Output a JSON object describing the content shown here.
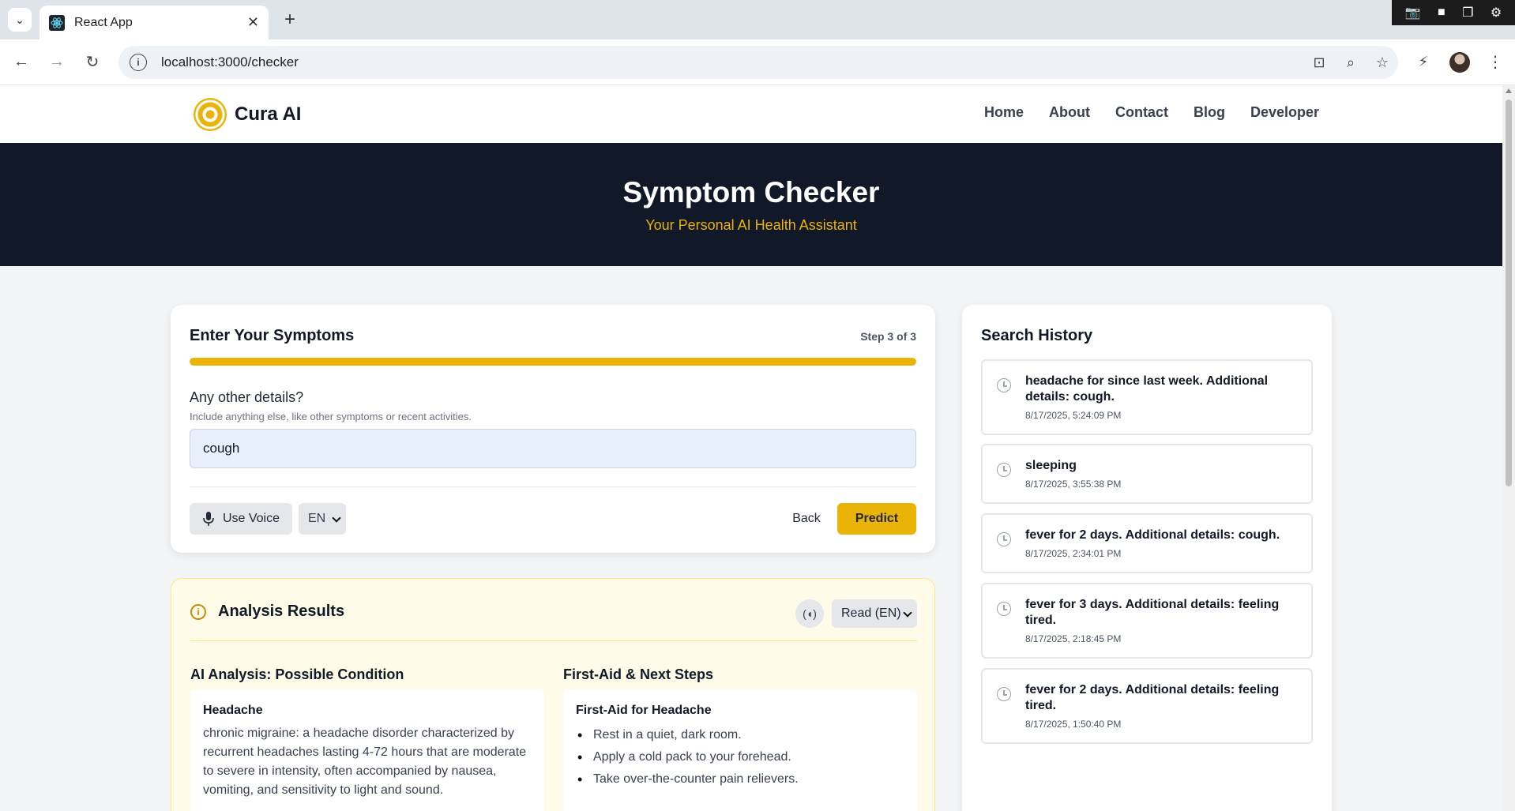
{
  "browser": {
    "tab_title": "React App",
    "url": "localhost:3000/checker"
  },
  "navbar": {
    "brand": "Cura AI",
    "links": [
      "Home",
      "About",
      "Contact",
      "Blog",
      "Developer"
    ]
  },
  "hero": {
    "title": "Symptom Checker",
    "subtitle": "Your Personal AI Health Assistant"
  },
  "symptom_form": {
    "title": "Enter Your Symptoms",
    "step_label": "Step 3 of 3",
    "progress": 1.0,
    "question": "Any other details?",
    "hint": "Include anything else, like other symptoms or recent activities.",
    "input_value": "cough",
    "voice_label": "Use Voice",
    "language": "EN",
    "back_label": "Back",
    "predict_label": "Predict"
  },
  "results": {
    "title": "Analysis Results",
    "read_option": "Read (EN)",
    "condition_heading": "AI Analysis: Possible Condition",
    "condition_name": "Headache",
    "condition_description": "chronic migraine: a headache disorder characterized by recurrent headaches lasting 4-72 hours that are moderate to severe in intensity, often accompanied by nausea, vomiting, and sensitivity to light and sound.",
    "first_aid_heading": "First-Aid & Next Steps",
    "first_aid_title": "First-Aid for Headache",
    "first_aid_steps": [
      "Rest in a quiet, dark room.",
      "Apply a cold pack to your forehead.",
      "Take over-the-counter pain relievers."
    ]
  },
  "history": {
    "title": "Search History",
    "items": [
      {
        "query": "headache for since last week. Additional details: cough.",
        "time": "8/17/2025, 5:24:09 PM"
      },
      {
        "query": "sleeping",
        "time": "8/17/2025, 3:55:38 PM"
      },
      {
        "query": "fever for 2 days. Additional details: cough.",
        "time": "8/17/2025, 2:34:01 PM"
      },
      {
        "query": "fever for 3 days. Additional details: feeling tired.",
        "time": "8/17/2025, 2:18:45 PM"
      },
      {
        "query": "fever for 2 days. Additional details: feeling tired.",
        "time": "8/17/2025, 1:50:40 PM"
      }
    ]
  },
  "colors": {
    "accent": "#eab308",
    "hero_bg": "#111827",
    "results_bg": "#fefce8"
  }
}
